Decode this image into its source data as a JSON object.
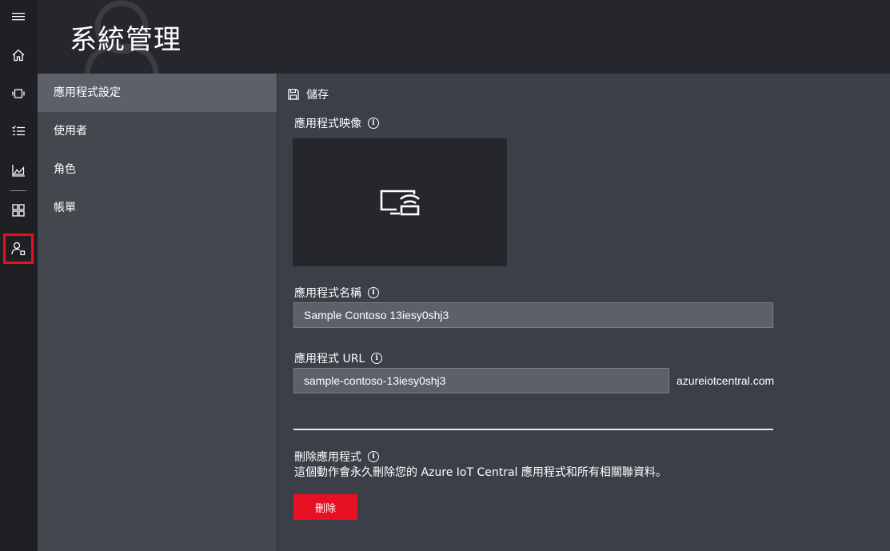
{
  "nav_rail": [
    {
      "icon": "hamburger-icon",
      "label": ""
    },
    {
      "icon": "home-icon",
      "label": ""
    },
    {
      "icon": "devices-icon",
      "label": ""
    },
    {
      "icon": "rules-list-icon",
      "label": ""
    },
    {
      "icon": "analytics-icon",
      "label": ""
    },
    {
      "icon": "dashboard-grid-icon",
      "label": ""
    },
    {
      "icon": "admin-user-icon",
      "label": "",
      "active": true
    }
  ],
  "header": {
    "title": "系統管理"
  },
  "subnav": {
    "items": [
      {
        "label": "應用程式設定",
        "active": true
      },
      {
        "label": "使用者"
      },
      {
        "label": "角色"
      },
      {
        "label": "帳單"
      }
    ]
  },
  "toolbar": {
    "save_label": "儲存"
  },
  "form": {
    "image_label": "應用程式映像",
    "name_label": "應用程式名稱",
    "name_value": "Sample Contoso 13iesy0shj3",
    "url_label": "應用程式 URL",
    "url_value": "sample-contoso-13iesy0shj3",
    "url_suffix": "azureiotcentral.com"
  },
  "delete_section": {
    "title": "刪除應用程式",
    "description": "這個動作會永久刪除您的 Azure IoT Central 應用程式和所有相關聯資料。",
    "button_label": "刪除"
  },
  "colors": {
    "rail_bg": "#1f2024",
    "header_bg": "#25272c",
    "subnav_bg": "#44474e",
    "main_bg": "#3c3f47",
    "accent_red": "#e81123"
  }
}
